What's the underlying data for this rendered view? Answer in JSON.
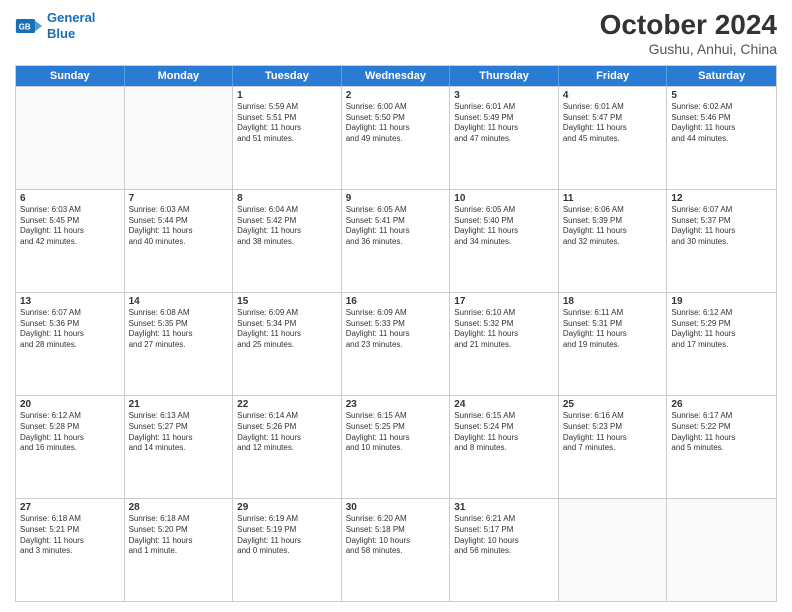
{
  "header": {
    "logo_line1": "General",
    "logo_line2": "Blue",
    "month": "October 2024",
    "location": "Gushu, Anhui, China"
  },
  "weekdays": [
    "Sunday",
    "Monday",
    "Tuesday",
    "Wednesday",
    "Thursday",
    "Friday",
    "Saturday"
  ],
  "rows": [
    [
      {
        "day": "",
        "info": "",
        "empty": true
      },
      {
        "day": "",
        "info": "",
        "empty": true
      },
      {
        "day": "1",
        "info": "Sunrise: 5:59 AM\nSunset: 5:51 PM\nDaylight: 11 hours\nand 51 minutes."
      },
      {
        "day": "2",
        "info": "Sunrise: 6:00 AM\nSunset: 5:50 PM\nDaylight: 11 hours\nand 49 minutes."
      },
      {
        "day": "3",
        "info": "Sunrise: 6:01 AM\nSunset: 5:49 PM\nDaylight: 11 hours\nand 47 minutes."
      },
      {
        "day": "4",
        "info": "Sunrise: 6:01 AM\nSunset: 5:47 PM\nDaylight: 11 hours\nand 45 minutes."
      },
      {
        "day": "5",
        "info": "Sunrise: 6:02 AM\nSunset: 5:46 PM\nDaylight: 11 hours\nand 44 minutes."
      }
    ],
    [
      {
        "day": "6",
        "info": "Sunrise: 6:03 AM\nSunset: 5:45 PM\nDaylight: 11 hours\nand 42 minutes."
      },
      {
        "day": "7",
        "info": "Sunrise: 6:03 AM\nSunset: 5:44 PM\nDaylight: 11 hours\nand 40 minutes."
      },
      {
        "day": "8",
        "info": "Sunrise: 6:04 AM\nSunset: 5:42 PM\nDaylight: 11 hours\nand 38 minutes."
      },
      {
        "day": "9",
        "info": "Sunrise: 6:05 AM\nSunset: 5:41 PM\nDaylight: 11 hours\nand 36 minutes."
      },
      {
        "day": "10",
        "info": "Sunrise: 6:05 AM\nSunset: 5:40 PM\nDaylight: 11 hours\nand 34 minutes."
      },
      {
        "day": "11",
        "info": "Sunrise: 6:06 AM\nSunset: 5:39 PM\nDaylight: 11 hours\nand 32 minutes."
      },
      {
        "day": "12",
        "info": "Sunrise: 6:07 AM\nSunset: 5:37 PM\nDaylight: 11 hours\nand 30 minutes."
      }
    ],
    [
      {
        "day": "13",
        "info": "Sunrise: 6:07 AM\nSunset: 5:36 PM\nDaylight: 11 hours\nand 28 minutes."
      },
      {
        "day": "14",
        "info": "Sunrise: 6:08 AM\nSunset: 5:35 PM\nDaylight: 11 hours\nand 27 minutes."
      },
      {
        "day": "15",
        "info": "Sunrise: 6:09 AM\nSunset: 5:34 PM\nDaylight: 11 hours\nand 25 minutes."
      },
      {
        "day": "16",
        "info": "Sunrise: 6:09 AM\nSunset: 5:33 PM\nDaylight: 11 hours\nand 23 minutes."
      },
      {
        "day": "17",
        "info": "Sunrise: 6:10 AM\nSunset: 5:32 PM\nDaylight: 11 hours\nand 21 minutes."
      },
      {
        "day": "18",
        "info": "Sunrise: 6:11 AM\nSunset: 5:31 PM\nDaylight: 11 hours\nand 19 minutes."
      },
      {
        "day": "19",
        "info": "Sunrise: 6:12 AM\nSunset: 5:29 PM\nDaylight: 11 hours\nand 17 minutes."
      }
    ],
    [
      {
        "day": "20",
        "info": "Sunrise: 6:12 AM\nSunset: 5:28 PM\nDaylight: 11 hours\nand 16 minutes."
      },
      {
        "day": "21",
        "info": "Sunrise: 6:13 AM\nSunset: 5:27 PM\nDaylight: 11 hours\nand 14 minutes."
      },
      {
        "day": "22",
        "info": "Sunrise: 6:14 AM\nSunset: 5:26 PM\nDaylight: 11 hours\nand 12 minutes."
      },
      {
        "day": "23",
        "info": "Sunrise: 6:15 AM\nSunset: 5:25 PM\nDaylight: 11 hours\nand 10 minutes."
      },
      {
        "day": "24",
        "info": "Sunrise: 6:15 AM\nSunset: 5:24 PM\nDaylight: 11 hours\nand 8 minutes."
      },
      {
        "day": "25",
        "info": "Sunrise: 6:16 AM\nSunset: 5:23 PM\nDaylight: 11 hours\nand 7 minutes."
      },
      {
        "day": "26",
        "info": "Sunrise: 6:17 AM\nSunset: 5:22 PM\nDaylight: 11 hours\nand 5 minutes."
      }
    ],
    [
      {
        "day": "27",
        "info": "Sunrise: 6:18 AM\nSunset: 5:21 PM\nDaylight: 11 hours\nand 3 minutes."
      },
      {
        "day": "28",
        "info": "Sunrise: 6:18 AM\nSunset: 5:20 PM\nDaylight: 11 hours\nand 1 minute."
      },
      {
        "day": "29",
        "info": "Sunrise: 6:19 AM\nSunset: 5:19 PM\nDaylight: 11 hours\nand 0 minutes."
      },
      {
        "day": "30",
        "info": "Sunrise: 6:20 AM\nSunset: 5:18 PM\nDaylight: 10 hours\nand 58 minutes."
      },
      {
        "day": "31",
        "info": "Sunrise: 6:21 AM\nSunset: 5:17 PM\nDaylight: 10 hours\nand 56 minutes."
      },
      {
        "day": "",
        "info": "",
        "empty": true
      },
      {
        "day": "",
        "info": "",
        "empty": true
      }
    ]
  ]
}
